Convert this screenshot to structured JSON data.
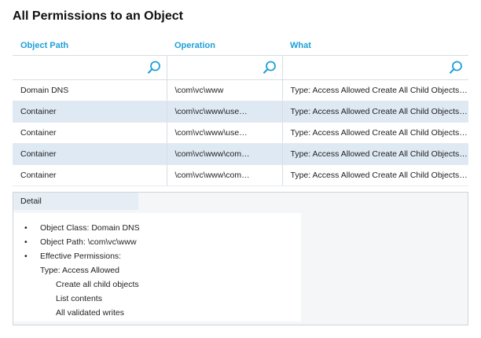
{
  "title": "All Permissions to an Object",
  "columns": [
    "Object Path",
    "Operation",
    "What"
  ],
  "rows": [
    [
      "Domain DNS",
      "\\com\\vc\\www",
      "Type: Access Allowed Create All Child Objects…"
    ],
    [
      "Container",
      "\\com\\vc\\www\\use…",
      "Type: Access Allowed Create All Child Objects…"
    ],
    [
      "Container",
      "\\com\\vc\\www\\use…",
      "Type: Access Allowed Create All Child Objects…"
    ],
    [
      "Container",
      "\\com\\vc\\www\\com…",
      "Type: Access Allowed Create All Child Objects…"
    ],
    [
      "Container",
      "\\com\\vc\\www\\com…",
      "Type: Access Allowed Create All Child Objects…"
    ]
  ],
  "detail": {
    "tab_label": "Detail",
    "items": [
      "Object Class: Domain DNS",
      "Object Path: \\com\\vc\\www",
      "Effective Permissions:"
    ],
    "type_line": "Type: Access Allowed",
    "permissions": [
      "Create all child objects",
      "List contents",
      "All validated writes"
    ]
  },
  "colors": {
    "accent": "#1ea0d8",
    "alt_row": "#dfe9f4"
  },
  "icons": {
    "filter": "search-icon"
  }
}
